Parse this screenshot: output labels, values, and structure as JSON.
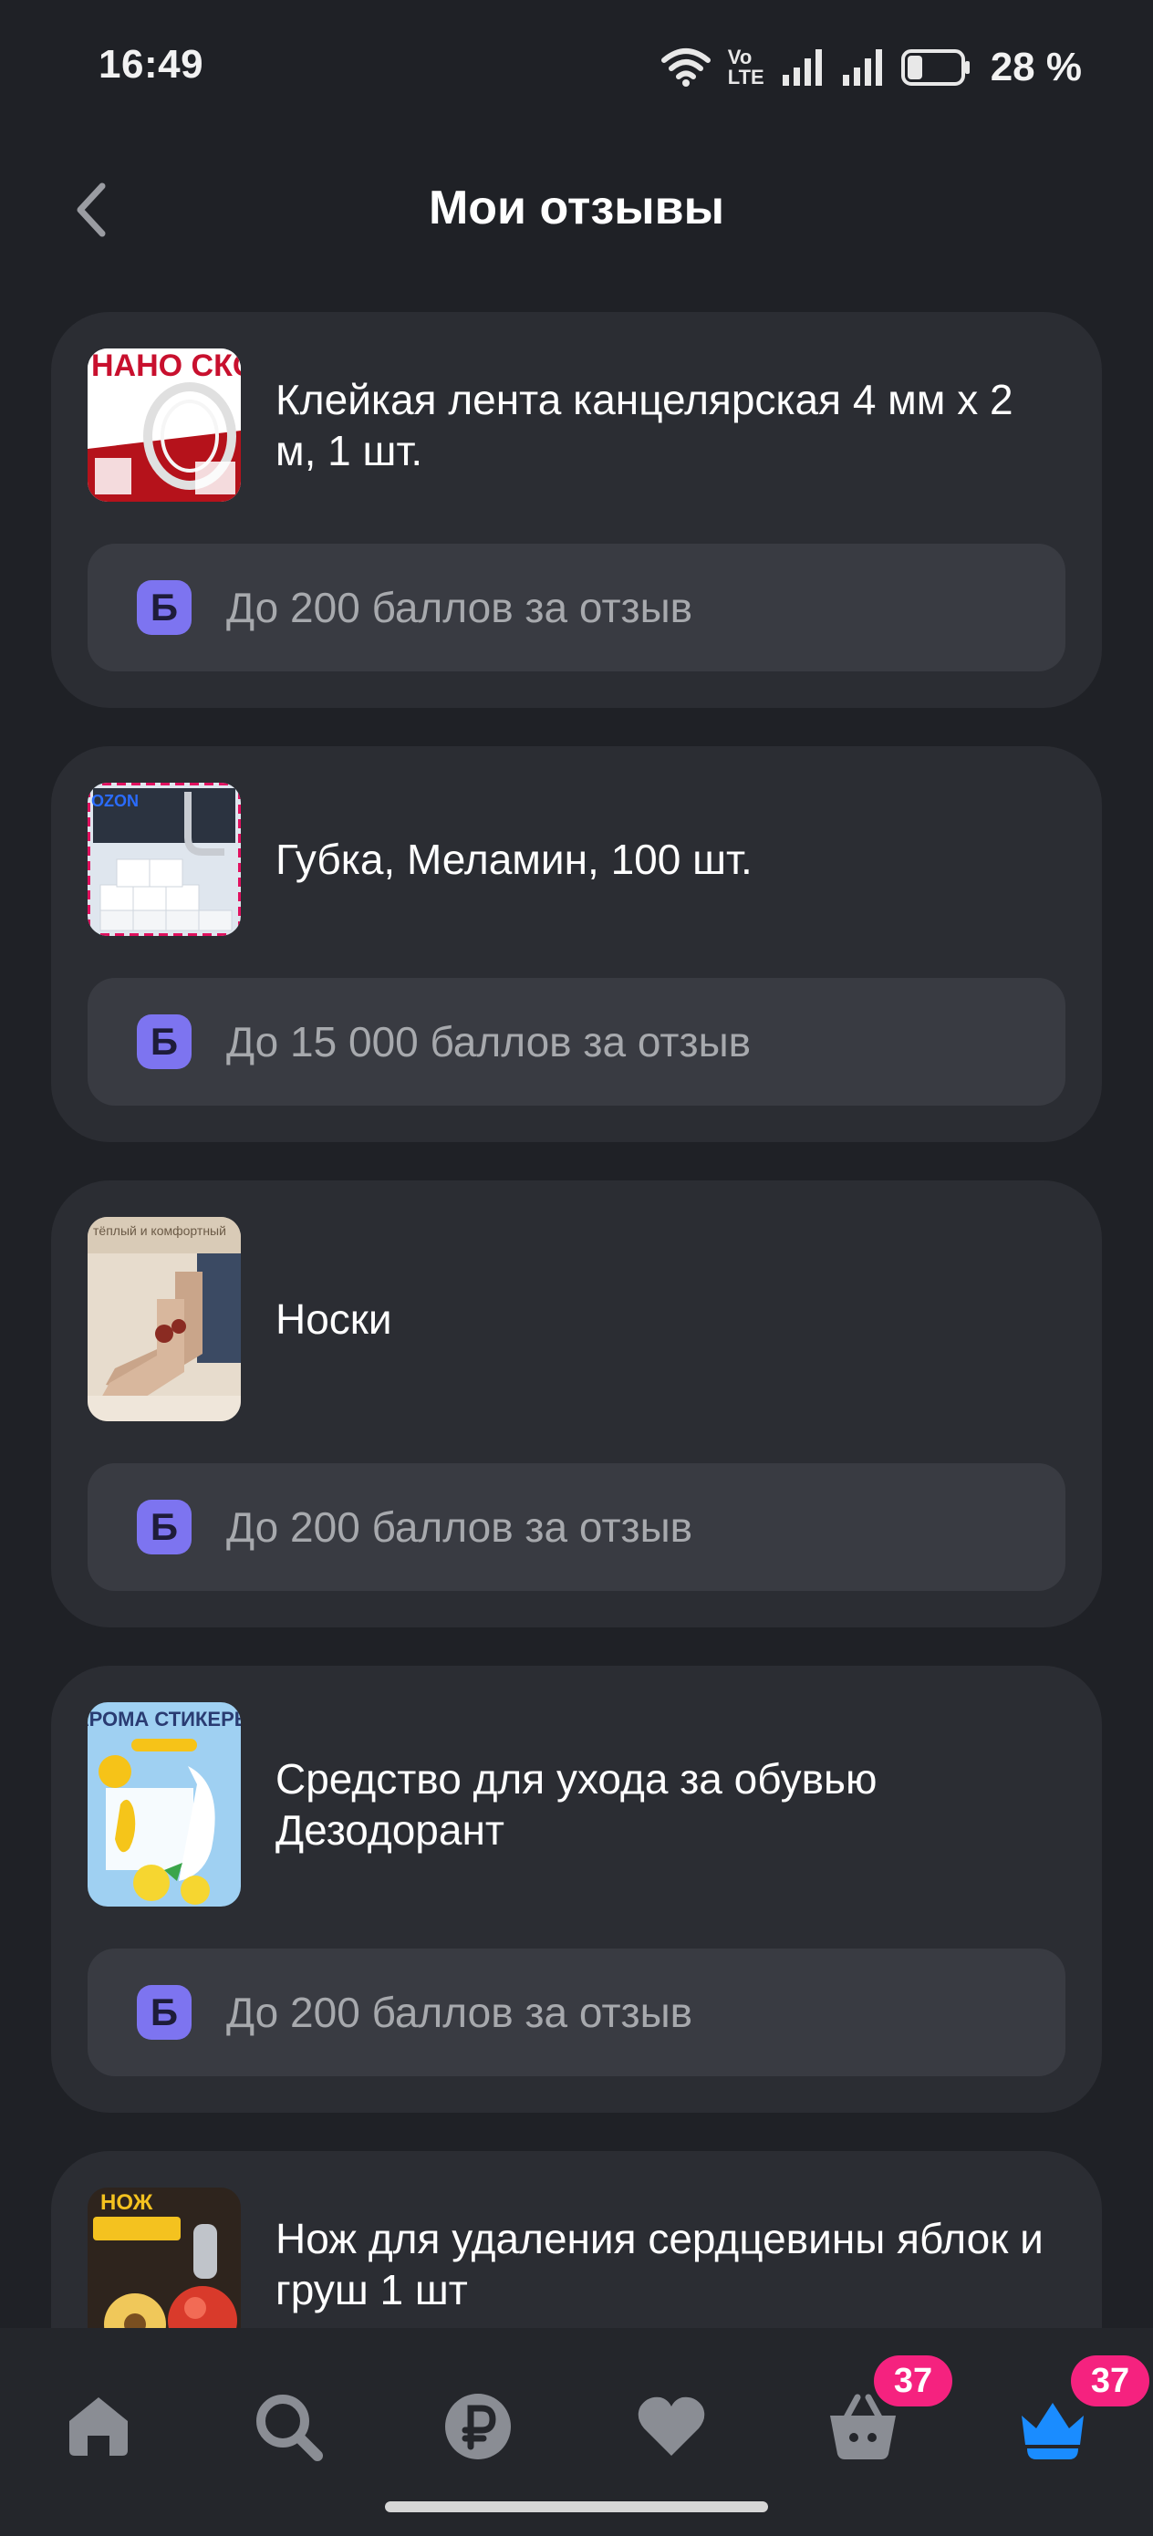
{
  "status_bar": {
    "time": "16:49",
    "volte_top": "Vo",
    "volte_bottom": "LTE",
    "battery_percent": "28 %",
    "battery_level": 0.28
  },
  "header": {
    "title": "Мои отзывы",
    "back_icon": "chevron-left-icon"
  },
  "reviews": [
    {
      "title": " Клейкая лента канцелярская 4 мм х 2 м, 1 шт.",
      "bonus_badge": "Б",
      "bonus_text": "До 200 баллов за отзыв",
      "thumb_caption": "НАНО СКОТЧ"
    },
    {
      "title": "Губка, Меламин, 100 шт.",
      "bonus_badge": "Б",
      "bonus_text": "До 15 000 баллов за отзыв",
      "thumb_caption": "OZON"
    },
    {
      "title": "Носки",
      "bonus_badge": "Б",
      "bonus_text": "До 200 баллов за отзыв",
      "thumb_caption": "тёплый и комфортный"
    },
    {
      "title": "Средство для ухода за обувью Дезодорант",
      "bonus_badge": "Б",
      "bonus_text": "До 200 баллов за отзыв",
      "thumb_caption": "АРОМА СТИКЕРЫ"
    },
    {
      "title": "Нож для удаления сердцевины яблок и груш 1 шт",
      "thumb_caption": "НОЖ"
    }
  ],
  "bottom_nav": {
    "items": [
      {
        "name": "home",
        "icon": "home-icon"
      },
      {
        "name": "search",
        "icon": "search-icon"
      },
      {
        "name": "finance",
        "icon": "ruble-icon"
      },
      {
        "name": "favorites",
        "icon": "heart-icon"
      },
      {
        "name": "cart",
        "icon": "basket-icon",
        "badge": "37"
      },
      {
        "name": "profile",
        "icon": "crown-icon",
        "badge": "37",
        "active": true
      }
    ]
  },
  "colors": {
    "background": "#1f2126",
    "card": "#2b2d33",
    "bonus_row": "#393b42",
    "bonus_badge": "#7d74f0",
    "badge_pink": "#f5227f",
    "active_blue": "#1a8cff",
    "nav_icon": "#8a8d94"
  }
}
